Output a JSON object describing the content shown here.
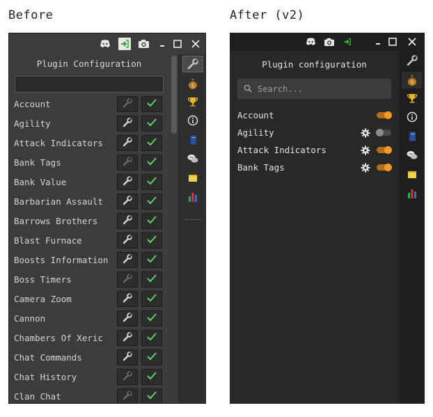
{
  "headings": {
    "before": "Before",
    "after": "After (v2)"
  },
  "before": {
    "title": "Plugin Configuration",
    "plugins": [
      {
        "name": "Account",
        "wrench_enabled": false,
        "checked": true
      },
      {
        "name": "Agility",
        "wrench_enabled": true,
        "checked": true
      },
      {
        "name": "Attack Indicators",
        "wrench_enabled": true,
        "checked": true
      },
      {
        "name": "Bank Tags",
        "wrench_enabled": false,
        "checked": true
      },
      {
        "name": "Bank Value",
        "wrench_enabled": true,
        "checked": true
      },
      {
        "name": "Barbarian Assault",
        "wrench_enabled": true,
        "checked": true
      },
      {
        "name": "Barrows Brothers",
        "wrench_enabled": true,
        "checked": true
      },
      {
        "name": "Blast Furnace",
        "wrench_enabled": true,
        "checked": true
      },
      {
        "name": "Boosts Information",
        "wrench_enabled": true,
        "checked": true
      },
      {
        "name": "Boss Timers",
        "wrench_enabled": false,
        "checked": true
      },
      {
        "name": "Camera Zoom",
        "wrench_enabled": true,
        "checked": true
      },
      {
        "name": "Cannon",
        "wrench_enabled": true,
        "checked": true
      },
      {
        "name": "Chambers Of Xeric",
        "wrench_enabled": true,
        "checked": true
      },
      {
        "name": "Chat Commands",
        "wrench_enabled": true,
        "checked": true
      },
      {
        "name": "Chat History",
        "wrench_enabled": false,
        "checked": true
      },
      {
        "name": "Clan Chat",
        "wrench_enabled": false,
        "checked": true
      }
    ]
  },
  "after": {
    "title": "Plugin configuration",
    "search_placeholder": "Search...",
    "plugins": [
      {
        "name": "Account",
        "has_settings": false,
        "enabled": true
      },
      {
        "name": "Agility",
        "has_settings": true,
        "enabled": false
      },
      {
        "name": "Attack Indicators",
        "has_settings": true,
        "enabled": true
      },
      {
        "name": "Bank Tags",
        "has_settings": true,
        "enabled": true
      }
    ]
  },
  "colors": {
    "accent_orange": "#f39a26",
    "check_green": "#5fd35f",
    "before_bg": "#3c3c3c",
    "after_bg": "#282828"
  },
  "icons": {
    "titlebar_before": [
      "discord-icon",
      "login-icon",
      "camera-icon",
      "minimize-icon",
      "maximize-icon",
      "close-icon"
    ],
    "titlebar_after": [
      "discord-icon",
      "camera-icon",
      "login-icon",
      "minimize-icon",
      "maximize-icon",
      "close-icon"
    ],
    "sidebar": [
      "wrench-icon",
      "money-bag-icon",
      "trophy-icon",
      "info-icon",
      "notes-book-icon",
      "chat-bubbles-icon",
      "sticky-note-icon",
      "bar-chart-icon"
    ]
  }
}
